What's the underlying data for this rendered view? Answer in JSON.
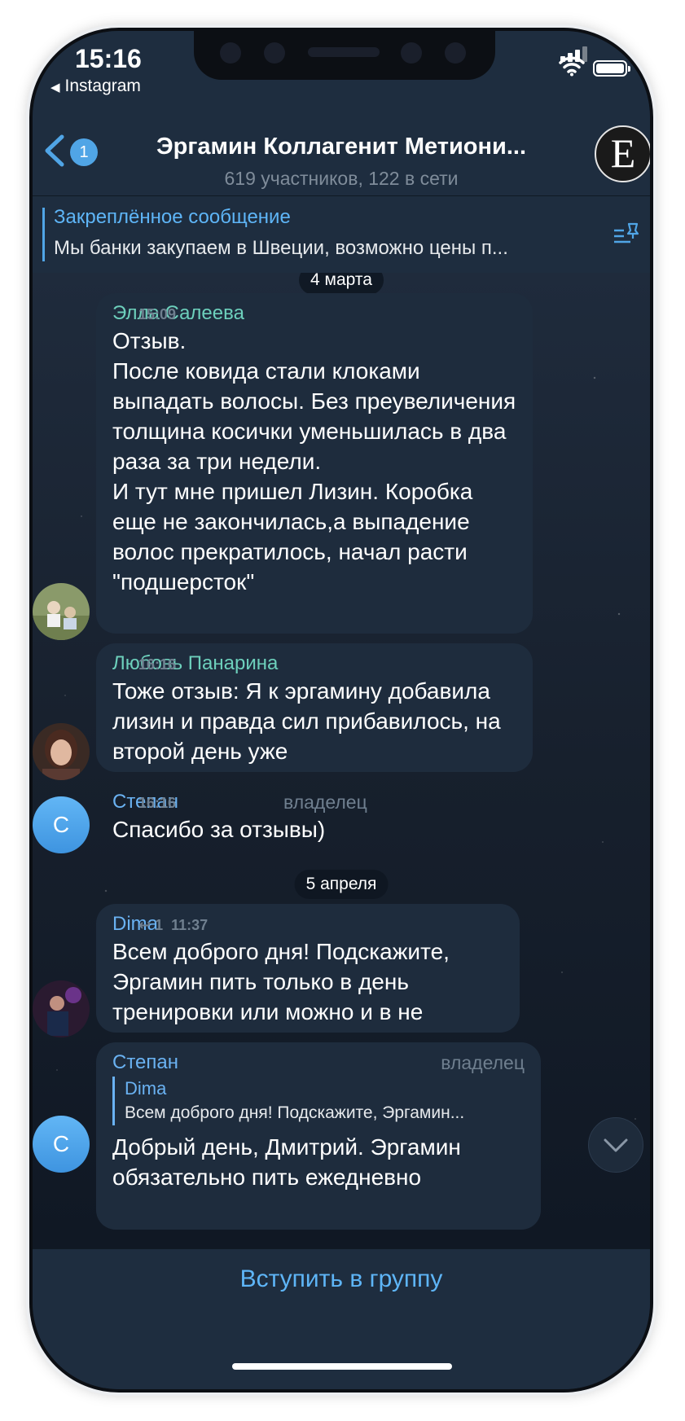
{
  "status_bar": {
    "time": "15:16",
    "back_app": "Instagram"
  },
  "header": {
    "unread_badge": "1",
    "title": "Эргамин Коллагенит Метиони...",
    "subtitle": "619 участников, 122 в сети",
    "avatar_letter": "E"
  },
  "pinned": {
    "title": "Закреплённое сообщение",
    "text": "Мы банки закупаем в Швеции, возможно цены п..."
  },
  "dates": {
    "d1": "4 марта",
    "d2": "5 апреля"
  },
  "messages": [
    {
      "author": "Элла Салеева",
      "text": "Отзыв.\nПосле ковида стали  клоками выпадать волосы.  Без преувеличения толщина косички уменьшилась в два раза за три недели.\nИ тут мне пришел Лизин.  Коробка еще не закончилась,а выпадение волос прекратилось, начал расти \"подшерсток\"",
      "time": "15:09"
    },
    {
      "author": "Любовь Панарина",
      "text": "Тоже отзыв: Я к эргамину добавила лизин и правда сил прибавилось, на второй день уже",
      "time": "16:16"
    },
    {
      "author": "Степан",
      "role": "владелец",
      "avatar_letter": "С",
      "text": "Спасибо за отзывы)",
      "time": "16:16"
    },
    {
      "author": "Dima",
      "text": "Всем доброго дня! Подскажите, Эргамин пить только в день тренировки или можно и в не",
      "replies": "1",
      "time": "11:37"
    },
    {
      "author": "Степан",
      "role": "владелец",
      "avatar_letter": "С",
      "reply_to_name": "Dima",
      "reply_to_text": "Всем доброго дня! Подскажите, Эргамин...",
      "text": "Добрый день, Дмитрий. Эргамин обязательно пить ежедневно"
    }
  ],
  "join_button": "Вступить в группу",
  "colors": {
    "accent": "#5eb5f7",
    "bubble": "#1e2c3d",
    "header": "#1e2d3f",
    "author_green": "#6dd0bc",
    "author_blue": "#6ab2f2"
  },
  "icons": [
    "back-chevron-icon",
    "signal-icon",
    "wifi-icon",
    "battery-icon",
    "pinned-list-icon",
    "reply-icon",
    "chevron-down-icon"
  ]
}
